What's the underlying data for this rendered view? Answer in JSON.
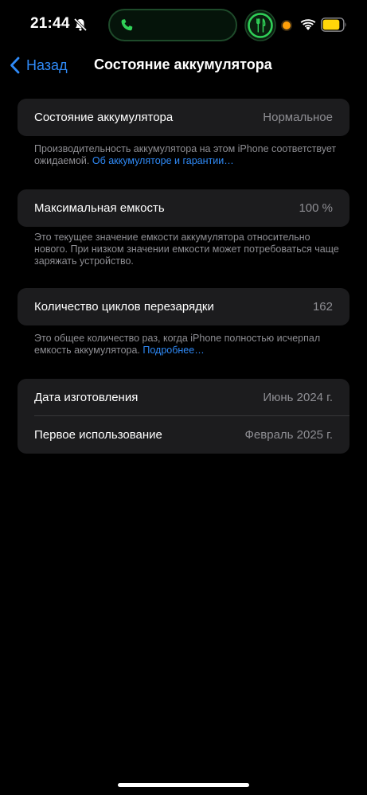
{
  "status_bar": {
    "time": "21:44",
    "icons": [
      "bell-slash-icon",
      "phone-icon",
      "fork-knife-icon",
      "orange-dot-icon",
      "wifi-icon",
      "battery-icon"
    ],
    "island_color": "#1e4a2a",
    "accent_green": "#30d158",
    "battery_color": "#ffd60a",
    "battery_level": 0.85
  },
  "nav": {
    "back_label": "Назад",
    "title": "Состояние аккумулятора"
  },
  "health": {
    "label": "Состояние аккумулятора",
    "value": "Нормальное",
    "note": "Производительность аккумулятора на этом iPhone соответствует ожидаемой.",
    "link": "Об аккумуляторе и гарантии…"
  },
  "capacity": {
    "label": "Максимальная емкость",
    "value": "100 %",
    "note": "Это текущее значение емкости аккумулятора относительно нового. При низком значении емкости может потребоваться чаще заряжать устройство."
  },
  "cycles": {
    "label": "Количество циклов перезарядки",
    "value": "162",
    "note": "Это общее количество раз, когда iPhone полностью исчерпал емкость аккумулятора.",
    "link": "Подробнее…"
  },
  "dates": {
    "manufacture_label": "Дата изготовления",
    "manufacture_value": "Июнь 2024 г.",
    "first_use_label": "Первое использование",
    "first_use_value": "Февраль 2025 г."
  },
  "colors": {
    "background": "#000000",
    "card": "#1c1c1e",
    "link": "#2f8af7",
    "secondary_text": "#8e8e93"
  }
}
